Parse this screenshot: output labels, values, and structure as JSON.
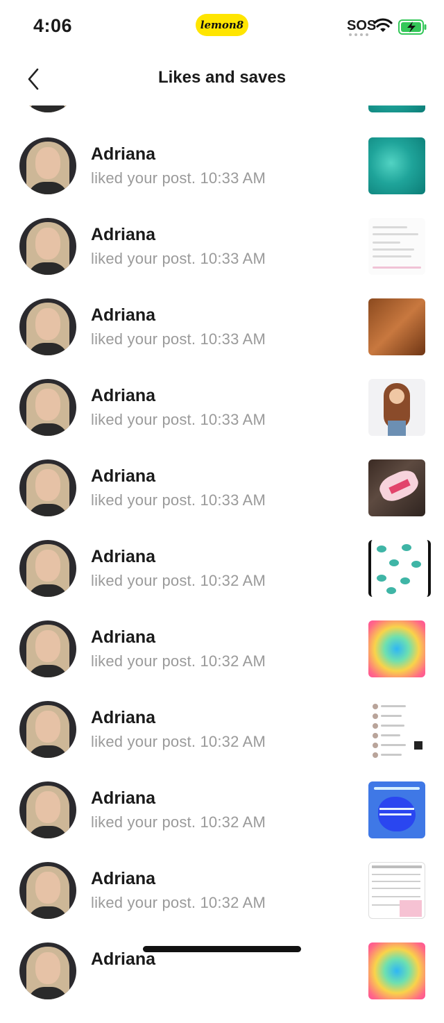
{
  "status_bar": {
    "time": "4:06",
    "brand": "lemon8",
    "sos": "SOS"
  },
  "header": {
    "title": "Likes and saves"
  },
  "notifications": [
    {
      "name": "Adriana",
      "action": "liked your post.",
      "time": "10:33 AM"
    },
    {
      "name": "Adriana",
      "action": "liked your post.",
      "time": "10:33 AM"
    },
    {
      "name": "Adriana",
      "action": "liked your post.",
      "time": "10:33 AM"
    },
    {
      "name": "Adriana",
      "action": "liked your post.",
      "time": "10:33 AM"
    },
    {
      "name": "Adriana",
      "action": "liked your post.",
      "time": "10:33 AM"
    },
    {
      "name": "Adriana",
      "action": "liked your post.",
      "time": "10:32 AM"
    },
    {
      "name": "Adriana",
      "action": "liked your post.",
      "time": "10:32 AM"
    },
    {
      "name": "Adriana",
      "action": "liked your post.",
      "time": "10:32 AM"
    },
    {
      "name": "Adriana",
      "action": "liked your post.",
      "time": "10:32 AM"
    },
    {
      "name": "Adriana",
      "action": "liked your post.",
      "time": "10:32 AM"
    }
  ],
  "partial_bottom": {
    "name": "Adriana"
  },
  "colors": {
    "brand_yellow": "#ffe500",
    "battery_green": "#34c759",
    "secondary_text": "#9a9a9a"
  }
}
